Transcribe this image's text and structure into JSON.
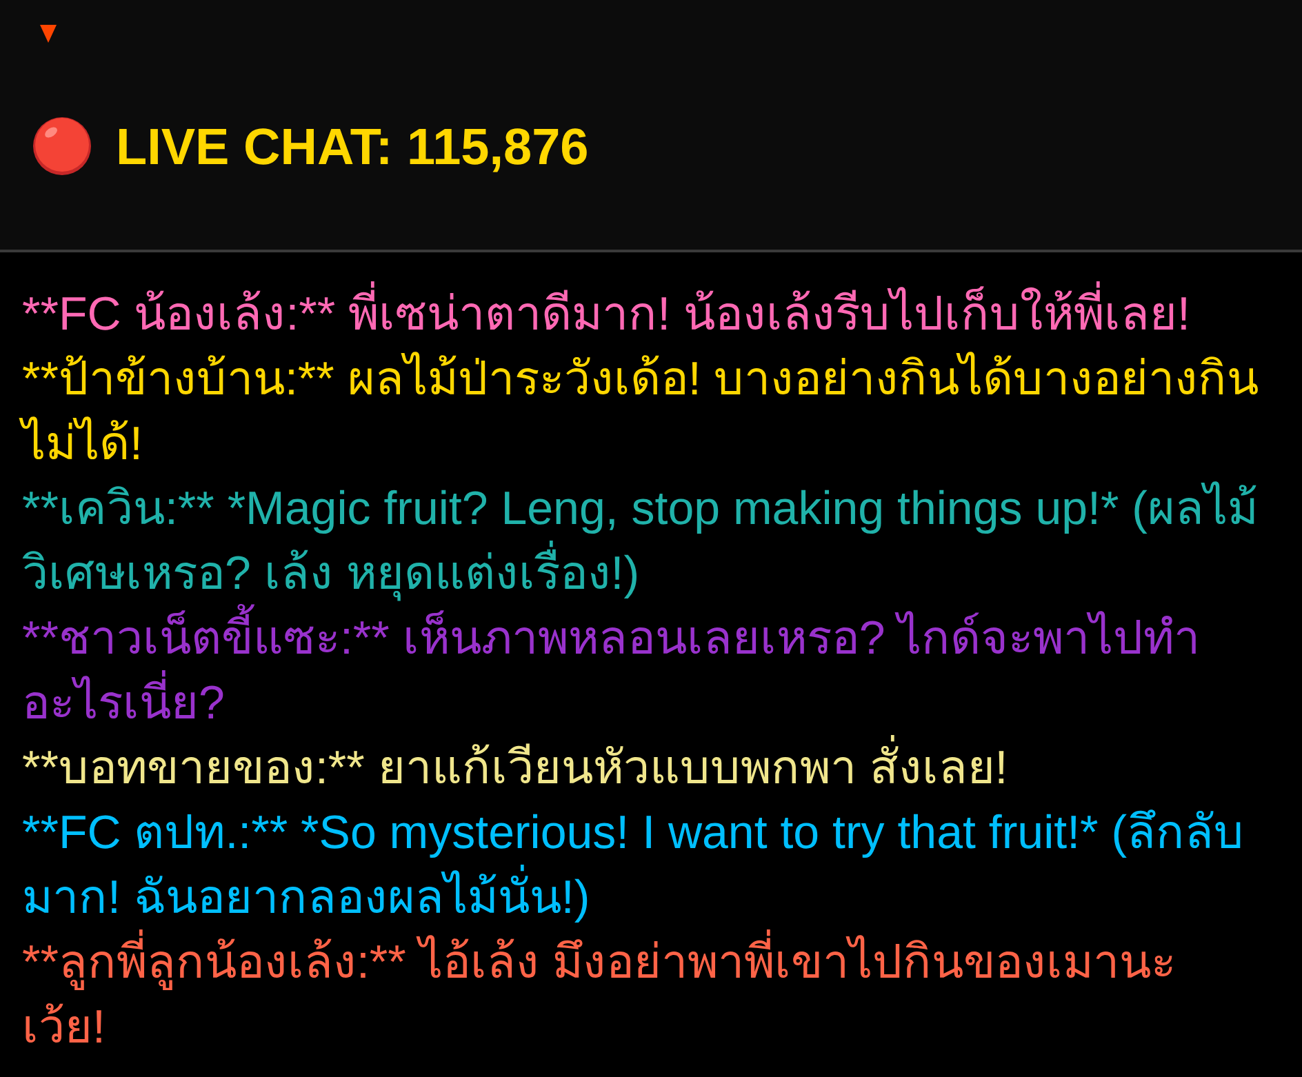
{
  "header": {
    "title": "LIVE CHAT: 115,876"
  },
  "messages": [
    {
      "text": "**FC น้องเล้ง:** พี่เซน่าตาดีมาก! น้องเล้งรีบไปเก็บให้พี่เลย!",
      "color": "#ff69b4"
    },
    {
      "text": "**ป้าข้างบ้าน:** ผลไม้ป่าระวังเด้อ! บางอย่างกินได้บางอย่างกิน ไม่ได้!",
      "color": "#ffd700"
    },
    {
      "text": "**เควิน:** *Magic fruit? Leng, stop making things up!* (ผลไม้วิเศษเหรอ? เล้ง หยุดแต่งเรื่อง!)",
      "color": "#20b2aa"
    },
    {
      "text": "**ชาวเน็ตขี้แซะ:** เห็นภาพหลอนเลยเหรอ? ไกด์จะพาไปทำอะไรเนี่ย?",
      "color": "#9932cc"
    },
    {
      "text": "**บอทขายของ:** ยาแก้เวียนหัวแบบพกพา สั่งเลย!",
      "color": "#f0e68c"
    },
    {
      "text": "**FC ตปท.:** *So mysterious! I want to try that fruit!* (ลึกลับมาก! ฉันอยากลองผลไม้นั่น!)",
      "color": "#00bfff"
    },
    {
      "text": "**ลูกพี่ลูกน้องเล้ง:** ไอ้เล้ง มึงอย่าพาพี่เขาไปกินของเมานะ เว้ย!",
      "color": "#ff6347"
    }
  ]
}
